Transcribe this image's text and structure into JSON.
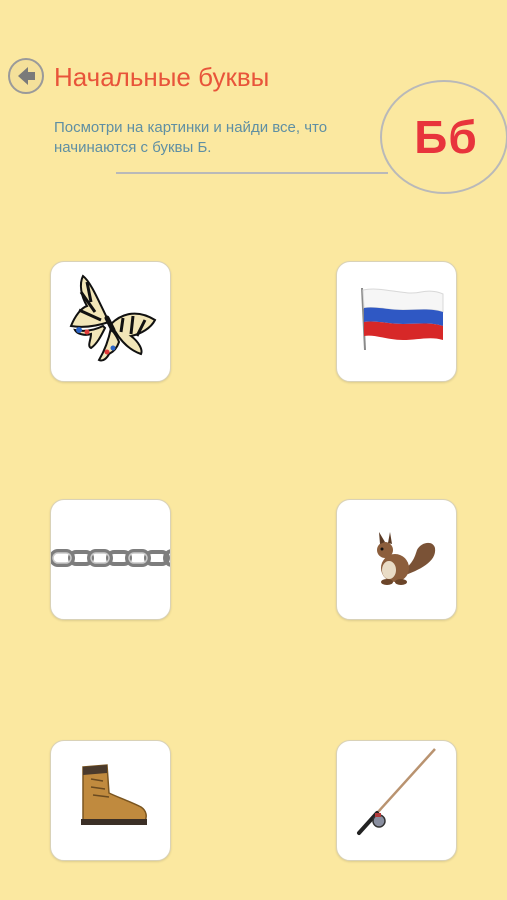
{
  "header": {
    "title": "Начальные буквы",
    "instruction": "Посмотри на картинки и найди все, что начинаются с буквы Б.",
    "letter": "Бб"
  },
  "cards": [
    {
      "name": "butterfly",
      "icon": "butterfly-icon"
    },
    {
      "name": "flag",
      "icon": "russian-flag-icon"
    },
    {
      "name": "chain",
      "icon": "chain-icon"
    },
    {
      "name": "squirrel",
      "icon": "squirrel-icon"
    },
    {
      "name": "boot",
      "icon": "boot-icon"
    },
    {
      "name": "fishing-rod",
      "icon": "fishing-rod-icon"
    }
  ],
  "colors": {
    "background": "#fbe8a0",
    "title": "#e8543a",
    "instruction": "#5f8fa3",
    "letter": "#e8343c",
    "card": "#ffffff"
  }
}
